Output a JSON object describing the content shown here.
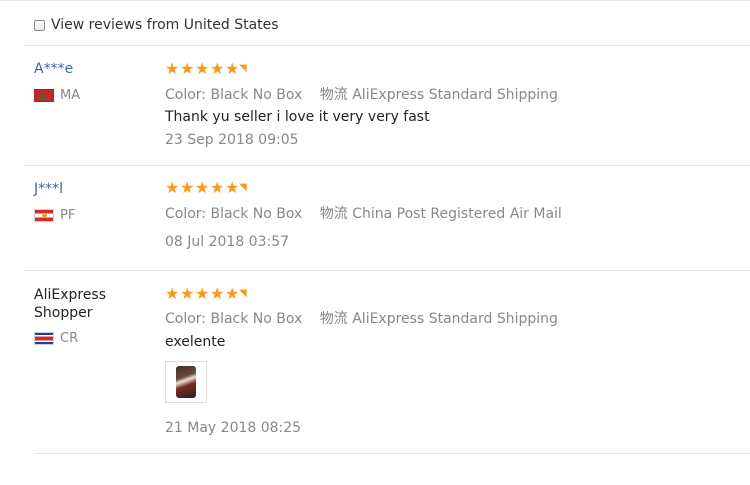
{
  "filter": {
    "label": "View reviews from United States"
  },
  "reviews": [
    {
      "user": "A***e",
      "country": "MA",
      "color_label": "Color: Black No Box",
      "shipping_prefix": "物流",
      "shipping": "AliExpress Standard Shipping",
      "text": "Thank yu seller i love it very very fast",
      "date": "23 Sep 2018 09:05",
      "rating": 5
    },
    {
      "user": "J***l",
      "country": "PF",
      "color_label": "Color: Black No Box",
      "shipping_prefix": "物流",
      "shipping": "China Post Registered Air Mail",
      "text": "",
      "date": "08 Jul 2018 03:57",
      "rating": 5
    },
    {
      "user": "AliExpress Shopper",
      "country": "CR",
      "color_label": "Color: Black No Box",
      "shipping_prefix": "物流",
      "shipping": "AliExpress Standard Shipping",
      "text": "exelente",
      "date": "21 May 2018 08:25",
      "rating": 5,
      "has_photo": true
    }
  ],
  "colors": {
    "star": "#f79a1e",
    "link": "#3c67a3",
    "muted": "#888888"
  },
  "icons": {
    "star": "star-icon",
    "flags": [
      "flag-ma-icon",
      "flag-pf-icon",
      "flag-cr-icon"
    ]
  }
}
